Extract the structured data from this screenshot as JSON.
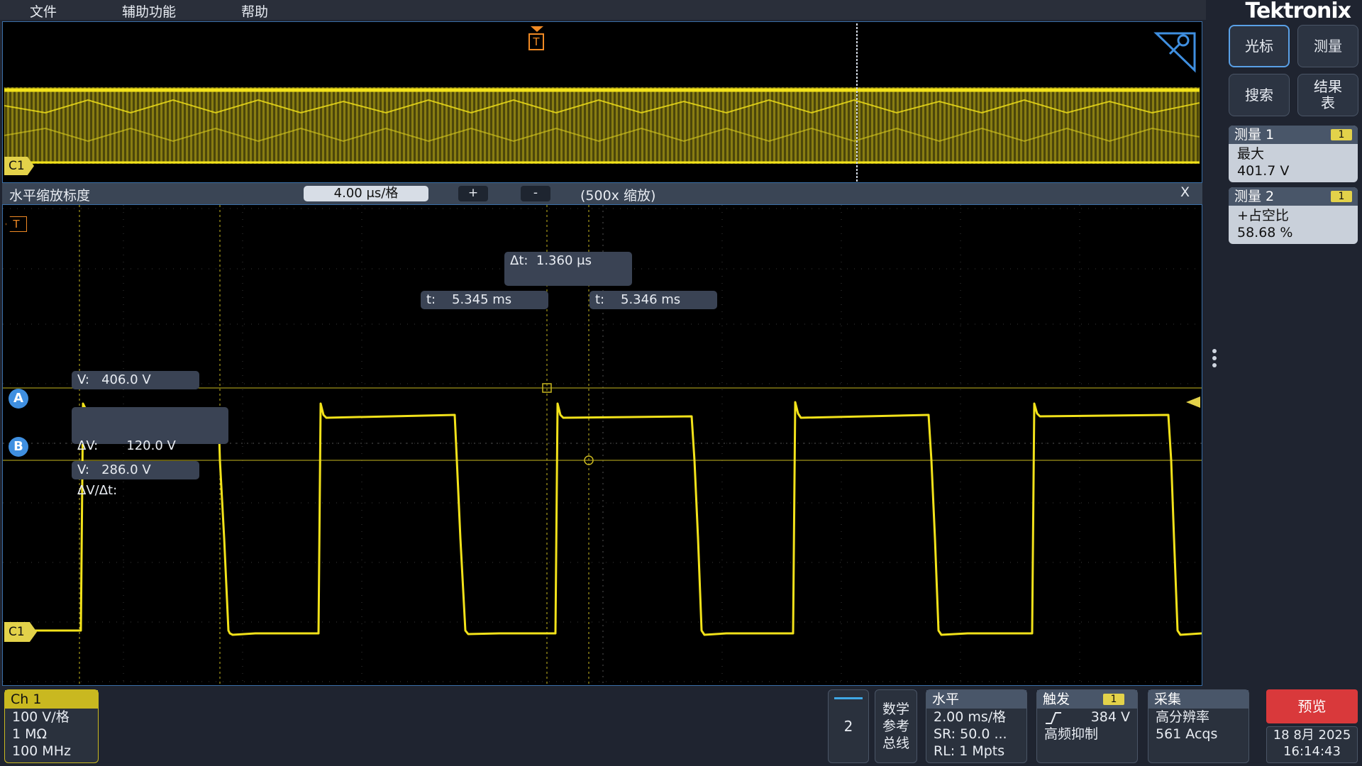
{
  "menu": {
    "file": "文件",
    "accessibility": "辅助功能",
    "help": "帮助"
  },
  "brand": "Tektronix",
  "overview": {
    "channel_label": "C1",
    "trigger_label": "T"
  },
  "zoom": {
    "title": "水平缩放标度",
    "scale": "4.00 μs/格",
    "plus": "+",
    "minus": "-",
    "factor": "(500x 缩放)",
    "close": "X"
  },
  "main": {
    "channel_label": "C1",
    "trigger_label": "T",
    "cursor_a_label": "A",
    "cursor_b_label": "B",
    "delta_t": "Δt:  1.360 μs",
    "t1": "t:    5.345 ms",
    "t2": "t:    5.346 ms",
    "v_a": "V:   406.0 V",
    "delta_v": "ΔV:       120.0 V",
    "delta_v_dt": "ΔV/Δt:",
    "v_b": "V:   286.0 V"
  },
  "right": {
    "cursor_btn": "光标",
    "measure_btn": "测量",
    "search_btn": "搜索",
    "results_btn_line1": "结果",
    "results_btn_line2": "表",
    "meas1": {
      "title": "测量 1",
      "badge": "1",
      "name": "最大",
      "value": "401.7 V"
    },
    "meas2": {
      "title": "测量 2",
      "badge": "1",
      "name": "+占空比",
      "value": "58.68 %"
    }
  },
  "bottom": {
    "ch1": {
      "title": "Ch 1",
      "scale": "100 V/格",
      "impedance": "1 MΩ",
      "bandwidth": "100 MHz"
    },
    "add_number": "2",
    "math": {
      "l1": "数学",
      "l2": "参考",
      "l3": "总线"
    },
    "horizontal": {
      "title": "水平",
      "scale": "2.00 ms/格",
      "sr": "SR: 50.0 ...",
      "rl": "RL: 1 Mpts"
    },
    "trigger": {
      "title": "触发",
      "badge": "1",
      "level": "384 V",
      "mode": "高频抑制"
    },
    "acquire": {
      "title": "采集",
      "mode": "高分辨率",
      "count": "561 Acqs"
    },
    "preview": "预览",
    "date": "18 8月 2025",
    "time": "16:14:43"
  },
  "colors": {
    "trace": "#f2e21a",
    "accent": "#3f8fe0",
    "trigger": "#f08a24",
    "preview": "#d9393b"
  }
}
